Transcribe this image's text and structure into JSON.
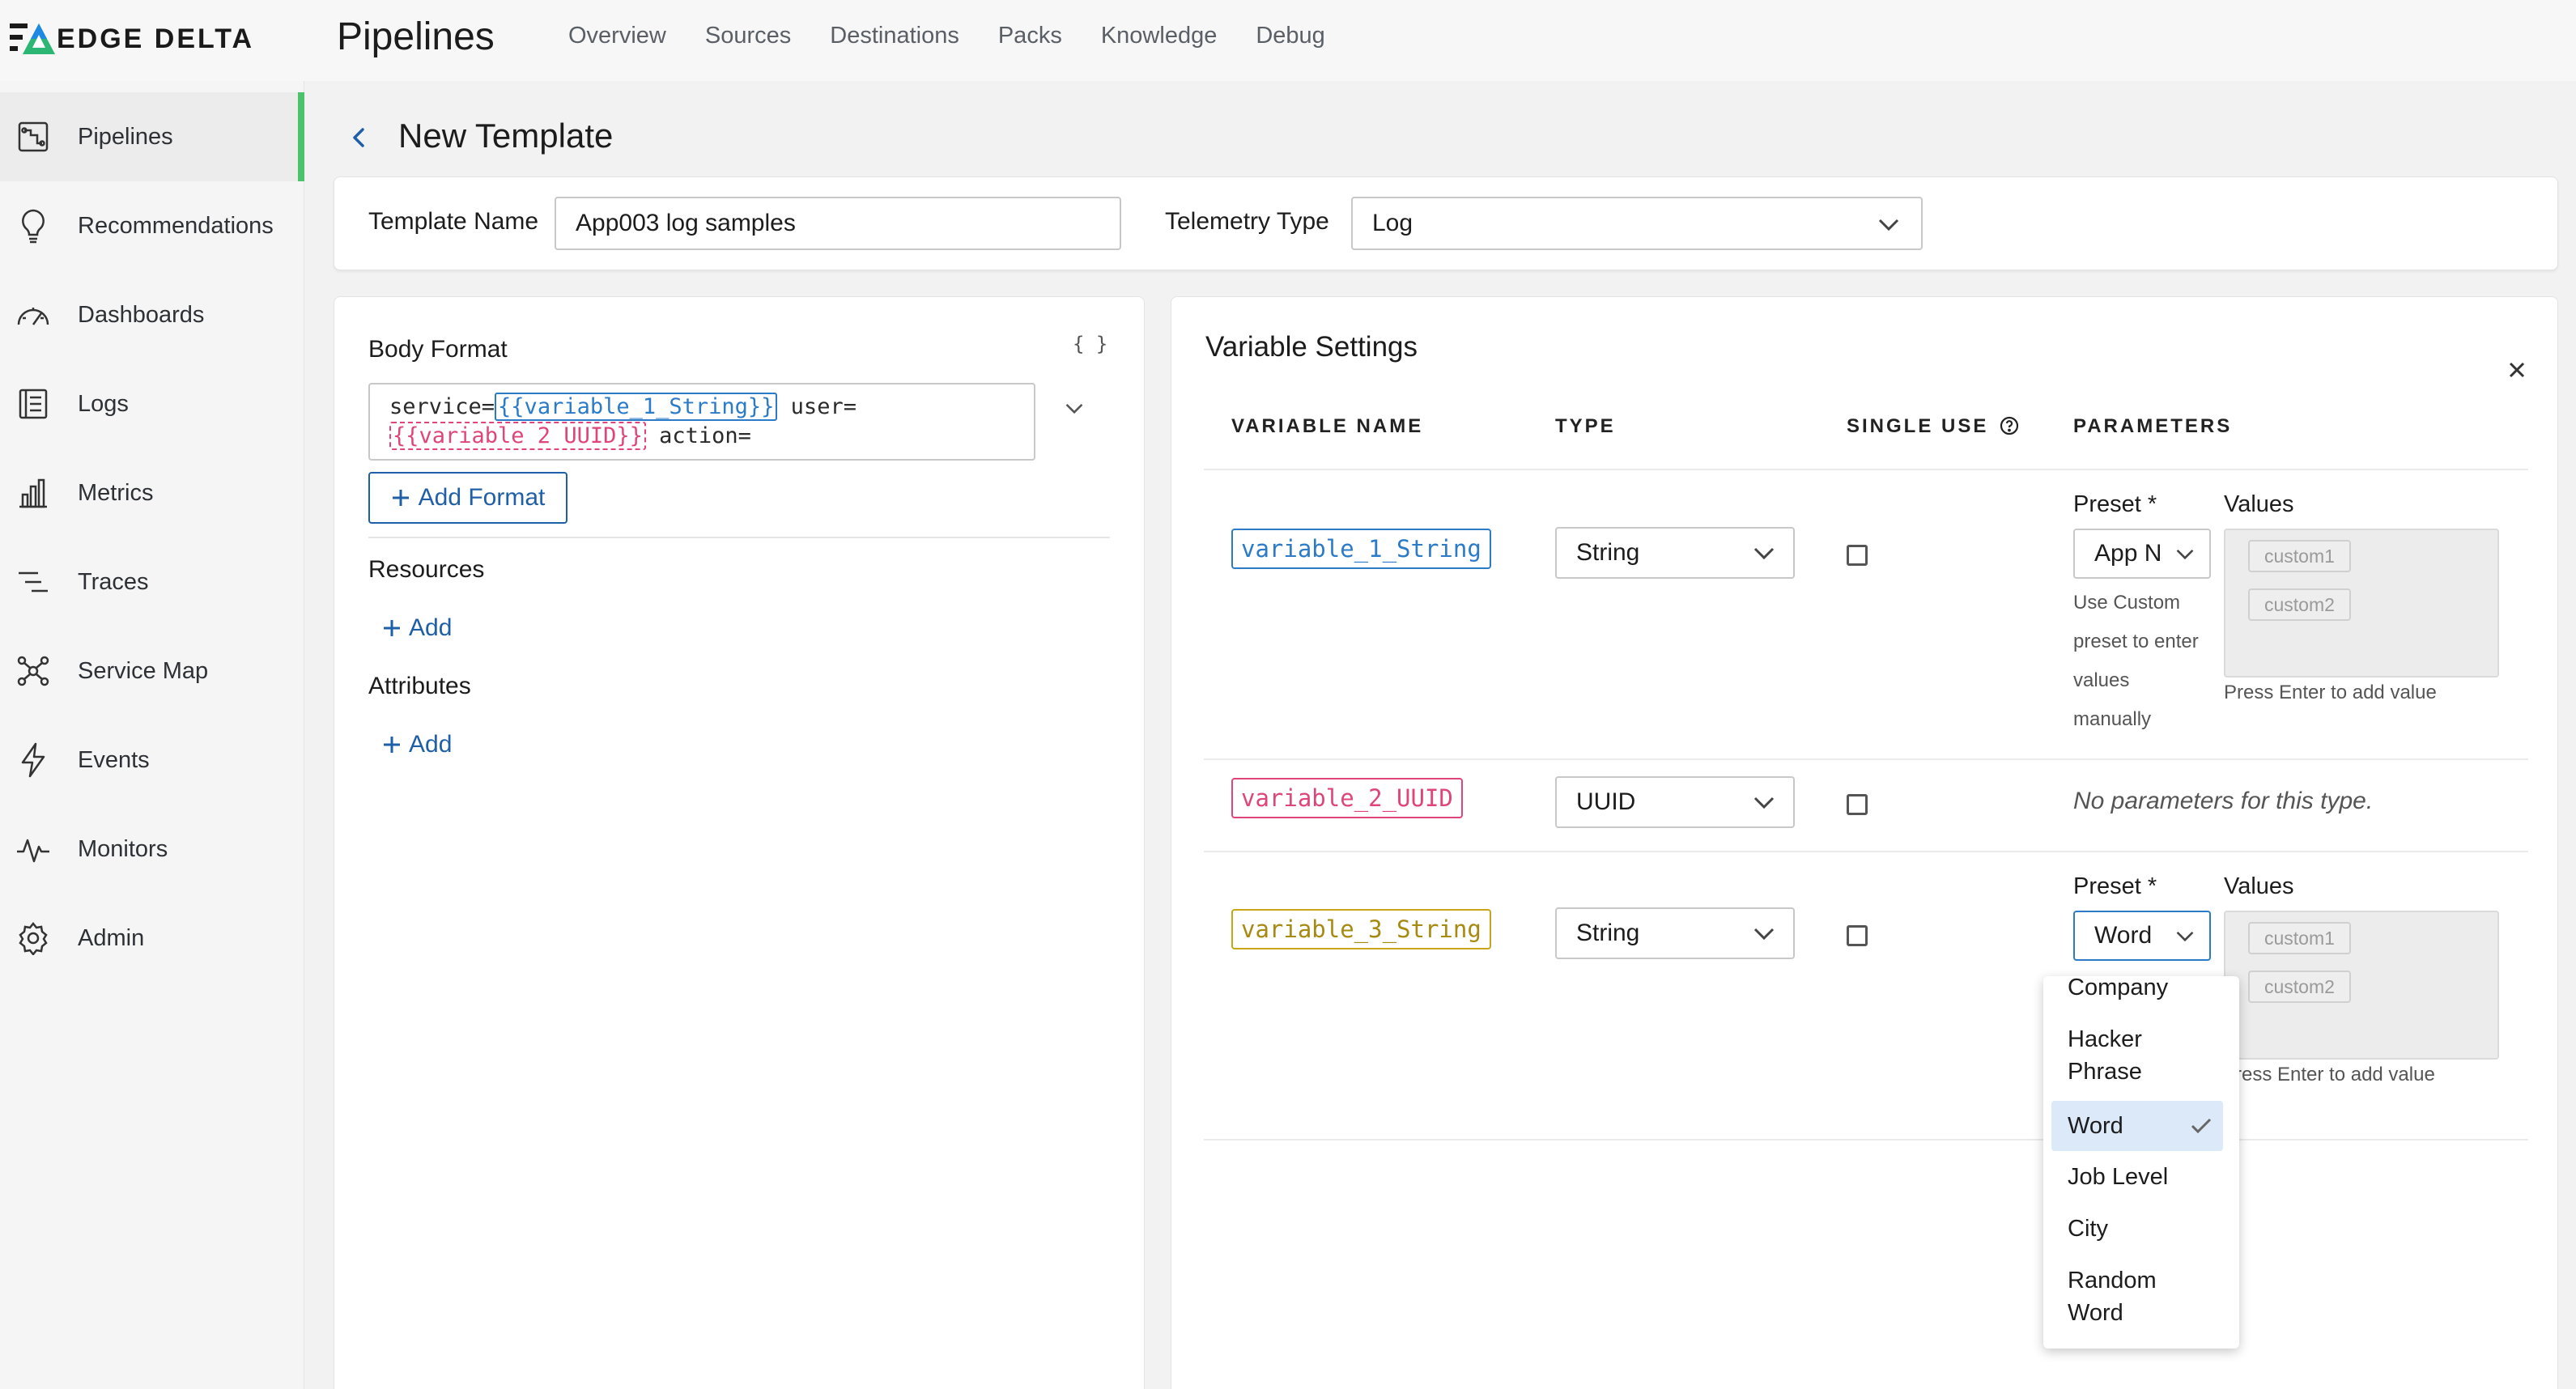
{
  "brand": {
    "name": "EDGE DELTA"
  },
  "header": {
    "title": "Pipelines",
    "nav": [
      "Overview",
      "Sources",
      "Destinations",
      "Packs",
      "Knowledge",
      "Debug"
    ]
  },
  "sidebar": {
    "items": [
      {
        "label": "Pipelines",
        "icon": "pipelines-icon",
        "active": true
      },
      {
        "label": "Recommendations",
        "icon": "lightbulb-icon"
      },
      {
        "label": "Dashboards",
        "icon": "gauge-icon"
      },
      {
        "label": "Logs",
        "icon": "logs-icon"
      },
      {
        "label": "Metrics",
        "icon": "bar-chart-icon"
      },
      {
        "label": "Traces",
        "icon": "traces-icon"
      },
      {
        "label": "Service Map",
        "icon": "service-map-icon"
      },
      {
        "label": "Events",
        "icon": "lightning-icon"
      },
      {
        "label": "Monitors",
        "icon": "pulse-icon"
      },
      {
        "label": "Admin",
        "icon": "gear-icon"
      }
    ]
  },
  "page": {
    "title": "New Template"
  },
  "template": {
    "name_label": "Template Name",
    "name_value": "App003 log samples",
    "telemetry_label": "Telemetry Type",
    "telemetry_value": "Log"
  },
  "body_format": {
    "title": "Body Format",
    "braces": "{ }",
    "line1_prefix": "service=",
    "token1": "{{variable_1_String}}",
    "line1_suffix": " user=",
    "token2": "{{variable 2 UUID}}",
    "line2_suffix": " action=",
    "add_format": "Add Format",
    "resources_title": "Resources",
    "attributes_title": "Attributes",
    "add_label": "Add"
  },
  "variables": {
    "title": "Variable Settings",
    "columns": [
      "VARIABLE NAME",
      "TYPE",
      "SINGLE USE",
      "PARAMETERS"
    ],
    "rows": [
      {
        "name": "variable_1_String",
        "type": "String",
        "preset_label": "Preset *",
        "preset_value": "App N",
        "values_label": "Values",
        "hint": [
          "Use Custom",
          "preset to enter",
          "values",
          "manually"
        ],
        "chips": [
          "custom1",
          "custom2"
        ],
        "press_enter": "Press Enter to add value"
      },
      {
        "name": "variable_2_UUID",
        "type": "UUID",
        "no_params": "No parameters for this type."
      },
      {
        "name": "variable_3_String",
        "type": "String",
        "preset_label": "Preset *",
        "preset_value": "Word",
        "values_label": "Values",
        "chips": [
          "custom1",
          "custom2"
        ],
        "press_enter": "ress Enter to add value"
      }
    ]
  },
  "dropdown": {
    "options": [
      "Company",
      "Hacker Phrase",
      "Word",
      "Job Level",
      "City",
      "Random Word"
    ],
    "selected": "Word"
  },
  "colors": {
    "accent_green": "#4cc26a",
    "link_blue": "#1f5fa8",
    "var1": "#2b7bc9",
    "var2": "#e0457a",
    "var3": "#c9a51a"
  }
}
